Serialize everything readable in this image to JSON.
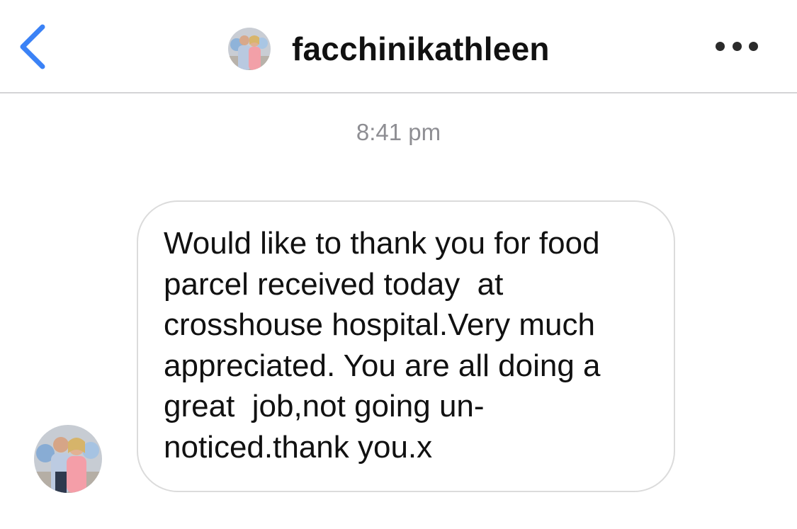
{
  "header": {
    "back_icon": "chevron-left-icon",
    "username": "facchinikathleen",
    "more_icon": "more-horizontal-icon",
    "accent_color": "#3b82f6"
  },
  "conversation": {
    "timestamp": "8:41 pm",
    "messages": [
      {
        "sender": "facchinikathleen",
        "text": "Would like to thank you for food\nparcel received today  at\ncrosshouse hospital.Very much\nappreciated. You are all doing a\ngreat  job,not going un-\nnoticed.thank you.x"
      }
    ]
  }
}
